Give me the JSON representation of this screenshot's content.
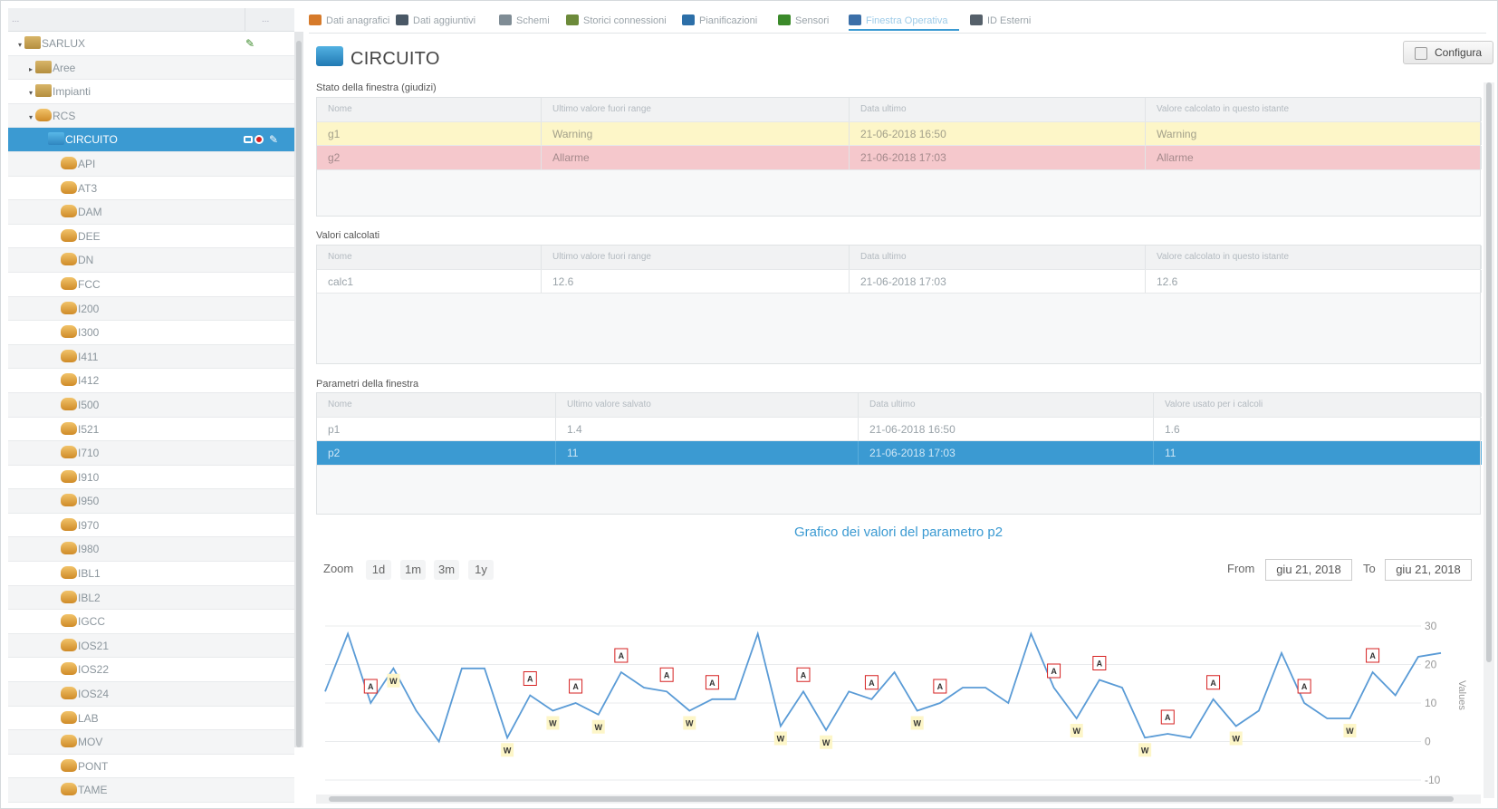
{
  "sidebar": {
    "header_left": "...",
    "header_right": "...",
    "items": [
      {
        "label": "SARLUX",
        "level": 0,
        "toggle": "▾",
        "icon": "folder"
      },
      {
        "label": "Aree",
        "level": 1,
        "toggle": "▸",
        "icon": "folder"
      },
      {
        "label": "Impianti",
        "level": 1,
        "toggle": "▾",
        "icon": "folder"
      },
      {
        "label": "RCS",
        "level": 2,
        "toggle": "▾",
        "icon": "db"
      },
      {
        "label": "CIRCUITO",
        "level": 3,
        "toggle": "",
        "icon": "blue"
      },
      {
        "label": "API",
        "level": 2,
        "toggle": "",
        "icon": "db"
      },
      {
        "label": "AT3",
        "level": 2,
        "toggle": "",
        "icon": "db"
      },
      {
        "label": "DAM",
        "level": 2,
        "toggle": "",
        "icon": "db"
      },
      {
        "label": "DEE",
        "level": 2,
        "toggle": "",
        "icon": "db"
      },
      {
        "label": "DN",
        "level": 2,
        "toggle": "",
        "icon": "db"
      },
      {
        "label": "FCC",
        "level": 2,
        "toggle": "",
        "icon": "db"
      },
      {
        "label": "I200",
        "level": 2,
        "toggle": "",
        "icon": "db"
      },
      {
        "label": "I300",
        "level": 2,
        "toggle": "",
        "icon": "db"
      },
      {
        "label": "I411",
        "level": 2,
        "toggle": "",
        "icon": "db"
      },
      {
        "label": "I412",
        "level": 2,
        "toggle": "",
        "icon": "db"
      },
      {
        "label": "I500",
        "level": 2,
        "toggle": "",
        "icon": "db"
      },
      {
        "label": "I521",
        "level": 2,
        "toggle": "",
        "icon": "db"
      },
      {
        "label": "I710",
        "level": 2,
        "toggle": "",
        "icon": "db"
      },
      {
        "label": "I910",
        "level": 2,
        "toggle": "",
        "icon": "db"
      },
      {
        "label": "I950",
        "level": 2,
        "toggle": "",
        "icon": "db"
      },
      {
        "label": "I970",
        "level": 2,
        "toggle": "",
        "icon": "db"
      },
      {
        "label": "I980",
        "level": 2,
        "toggle": "",
        "icon": "db"
      },
      {
        "label": "IBL1",
        "level": 2,
        "toggle": "",
        "icon": "db"
      },
      {
        "label": "IBL2",
        "level": 2,
        "toggle": "",
        "icon": "db"
      },
      {
        "label": "IGCC",
        "level": 2,
        "toggle": "",
        "icon": "db"
      },
      {
        "label": "IOS21",
        "level": 2,
        "toggle": "",
        "icon": "db"
      },
      {
        "label": "IOS22",
        "level": 2,
        "toggle": "",
        "icon": "db"
      },
      {
        "label": "IOS24",
        "level": 2,
        "toggle": "",
        "icon": "db"
      },
      {
        "label": "LAB",
        "level": 2,
        "toggle": "",
        "icon": "db"
      },
      {
        "label": "MOV",
        "level": 2,
        "toggle": "",
        "icon": "db"
      },
      {
        "label": "PONT",
        "level": 2,
        "toggle": "",
        "icon": "db"
      },
      {
        "label": "TAME",
        "level": 2,
        "toggle": "",
        "icon": "db"
      }
    ],
    "selected_index": 4
  },
  "tabs": [
    {
      "label": "Dati anagrafici",
      "color": "#d67a2a"
    },
    {
      "label": "Dati aggiuntivi",
      "color": "#4a5866"
    },
    {
      "label": "Schemi",
      "color": "#7f8c95"
    },
    {
      "label": "Storici connessioni",
      "color": "#6c8a3a"
    },
    {
      "label": "Pianificazioni",
      "color": "#2c6fa8"
    },
    {
      "label": "Sensori",
      "color": "#3b8a2a"
    },
    {
      "label": "Finestra Operativa",
      "color": "#3b6fa8",
      "active": true
    },
    {
      "label": "ID Esterni",
      "color": "#55606a"
    }
  ],
  "page_title": "CIRCUITO",
  "config_label": "Configura",
  "sections": {
    "stato": {
      "title": "Stato della finestra (giudizi)",
      "columns": [
        "Nome",
        "Ultimo valore fuori range",
        "Data ultimo",
        "Valore calcolato in questo istante"
      ],
      "rows": [
        {
          "cells": [
            "g1",
            "Warning",
            "21-06-2018 16:50",
            "Warning"
          ],
          "status": "warn"
        },
        {
          "cells": [
            "g2",
            "Allarme",
            "21-06-2018 17:03",
            "Allarme"
          ],
          "status": "alarm"
        }
      ]
    },
    "valori": {
      "title": "Valori calcolati",
      "columns": [
        "Nome",
        "Ultimo valore fuori range",
        "Data ultimo",
        "Valore calcolato in questo istante"
      ],
      "rows": [
        {
          "cells": [
            "calc1",
            "12.6",
            "21-06-2018 17:03",
            "12.6"
          ],
          "status": ""
        }
      ]
    },
    "parametri": {
      "title": "Parametri della finestra",
      "columns": [
        "Nome",
        "Ultimo valore salvato",
        "Data ultimo",
        "Valore usato per i calcoli"
      ],
      "rows": [
        {
          "cells": [
            "p1",
            "1.4",
            "21-06-2018 16:50",
            "1.6"
          ],
          "status": ""
        },
        {
          "cells": [
            "p2",
            "11",
            "21-06-2018 17:03",
            "11"
          ],
          "status": "sel"
        }
      ]
    }
  },
  "chart_controls": {
    "title": "Grafico dei valori del parametro p2",
    "zoom_label": "Zoom",
    "zoom_buttons": [
      "1d",
      "1m",
      "3m",
      "1y"
    ],
    "from_label": "From",
    "from_value": "giu 21, 2018",
    "to_label": "To",
    "to_value": "giu 21, 2018"
  },
  "chart_data": {
    "type": "line",
    "title": "Grafico dei valori del parametro p2",
    "ylabel": "Values",
    "ylim": [
      -10,
      30
    ],
    "yticks": [
      -10,
      0,
      10,
      20,
      30
    ],
    "series": [
      {
        "name": "p2",
        "color": "#5a9bd6",
        "values": [
          13,
          28,
          10,
          19,
          8,
          0,
          19,
          19,
          1,
          12,
          8,
          10,
          7,
          18,
          14,
          13,
          8,
          11,
          11,
          28,
          4,
          13,
          3,
          13,
          11,
          18,
          8,
          10,
          14,
          14,
          10,
          28,
          14,
          6,
          16,
          14,
          1,
          2,
          1,
          11,
          4,
          8,
          23,
          10,
          6,
          6,
          18,
          12,
          22,
          23
        ]
      }
    ],
    "flags": [
      {
        "i": 2,
        "type": "A"
      },
      {
        "i": 3,
        "type": "W"
      },
      {
        "i": 8,
        "type": "W"
      },
      {
        "i": 9,
        "type": "A"
      },
      {
        "i": 10,
        "type": "W"
      },
      {
        "i": 11,
        "type": "A"
      },
      {
        "i": 12,
        "type": "W"
      },
      {
        "i": 13,
        "type": "A"
      },
      {
        "i": 15,
        "type": "A"
      },
      {
        "i": 16,
        "type": "W"
      },
      {
        "i": 17,
        "type": "A"
      },
      {
        "i": 20,
        "type": "W"
      },
      {
        "i": 21,
        "type": "A"
      },
      {
        "i": 22,
        "type": "W"
      },
      {
        "i": 24,
        "type": "A"
      },
      {
        "i": 26,
        "type": "W"
      },
      {
        "i": 27,
        "type": "A"
      },
      {
        "i": 32,
        "type": "A"
      },
      {
        "i": 33,
        "type": "W"
      },
      {
        "i": 34,
        "type": "A"
      },
      {
        "i": 36,
        "type": "W"
      },
      {
        "i": 37,
        "type": "A"
      },
      {
        "i": 39,
        "type": "A"
      },
      {
        "i": 40,
        "type": "W"
      },
      {
        "i": 43,
        "type": "A"
      },
      {
        "i": 45,
        "type": "W"
      },
      {
        "i": 46,
        "type": "A"
      }
    ]
  }
}
